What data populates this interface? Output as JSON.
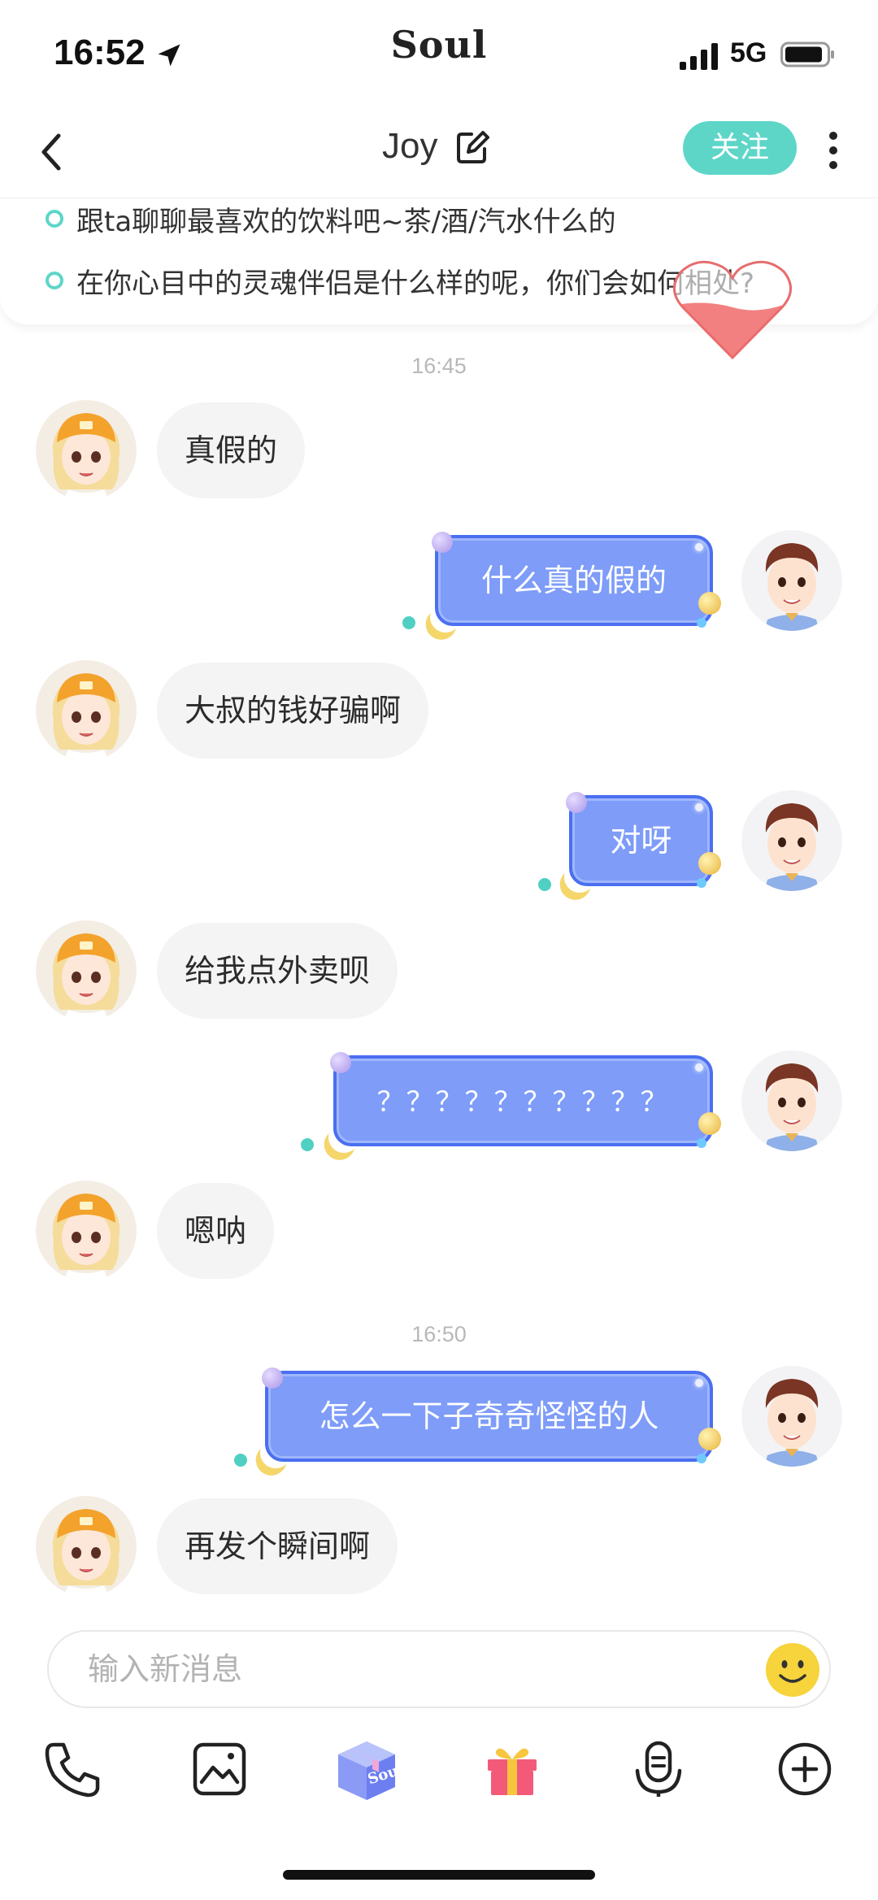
{
  "status_bar": {
    "time": "16:52",
    "brand": "Soul",
    "network": "5G"
  },
  "nav": {
    "title": "Joy",
    "follow_label": "关注"
  },
  "topics": [
    "跟ta聊聊最喜欢的饮料吧~茶/酒/汽水什么的",
    "在你心目中的灵魂伴侣是什么样的呢，你们会如何相处?"
  ],
  "timestamps": [
    "16:45",
    "16:50"
  ],
  "messages": [
    {
      "side": "in",
      "text": "真假的"
    },
    {
      "side": "out",
      "text": "什么真的假的"
    },
    {
      "side": "in",
      "text": "大叔的钱好骗啊"
    },
    {
      "side": "out",
      "text": "对呀"
    },
    {
      "side": "in",
      "text": "给我点外卖呗"
    },
    {
      "side": "out",
      "text": "？？？？？？？？？？"
    },
    {
      "side": "in",
      "text": "嗯呐"
    },
    {
      "side": "out",
      "text": "怎么一下子奇奇怪怪的人"
    },
    {
      "side": "in",
      "text": "再发个瞬间啊"
    }
  ],
  "input": {
    "placeholder": "输入新消息"
  },
  "toolbar": {
    "items": [
      "phone-icon",
      "image-icon",
      "soul-box-icon",
      "gift-icon",
      "voice-icon",
      "plus-icon"
    ],
    "soul_box_label": "Soul"
  },
  "colors": {
    "accent": "#5dd6c8",
    "outgoing_bubble": "#7e9cf8",
    "incoming_bubble": "#f4f4f5"
  }
}
